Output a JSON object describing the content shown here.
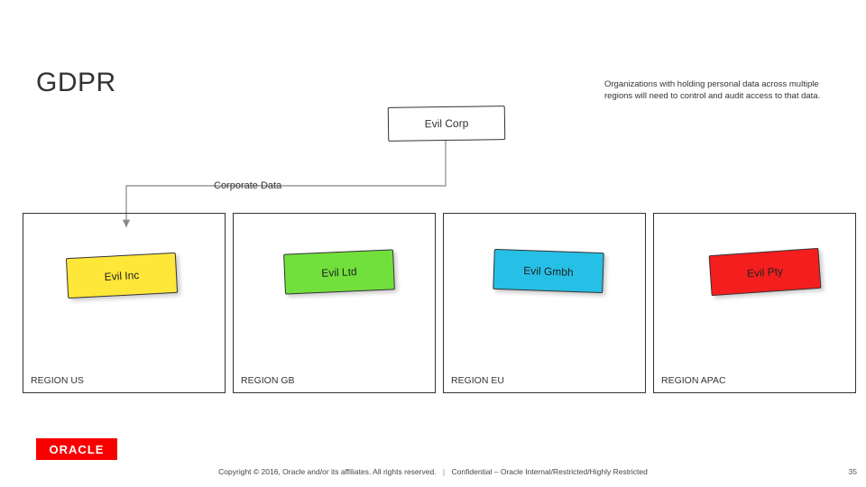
{
  "title": "GDPR",
  "subtitle": "Organizations with holding personal data across multiple regions will need to control and audit access to that data.",
  "top_box": "Evil Corp",
  "section_label": "Corporate Data",
  "regions": [
    {
      "card_label": "Evil Inc",
      "region_label": "REGION US"
    },
    {
      "card_label": "Evil Ltd",
      "region_label": "REGION GB"
    },
    {
      "card_label": "Evil Gmbh",
      "region_label": "REGION EU"
    },
    {
      "card_label": "Evil Pty",
      "region_label": "REGION APAC"
    }
  ],
  "logo_text": "ORACLE",
  "footer_copyright": "Copyright © 2016, Oracle and/or its affiliates. All rights reserved.",
  "footer_confidential": "Confidential – Oracle Internal/Restricted/Highly Restricted",
  "page_number": "35"
}
